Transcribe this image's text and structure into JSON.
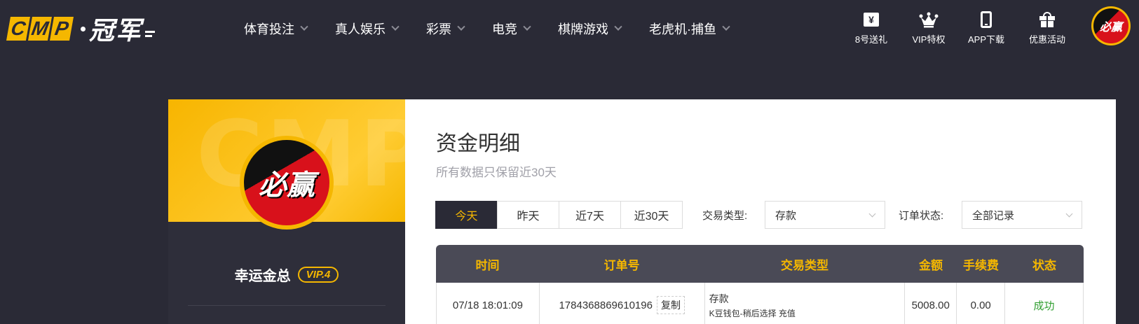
{
  "header": {
    "logo": {
      "letters": [
        "C",
        "M",
        "P"
      ],
      "text": "冠军"
    },
    "nav": [
      {
        "label": "体育投注"
      },
      {
        "label": "真人娱乐"
      },
      {
        "label": "彩票"
      },
      {
        "label": "电竞"
      },
      {
        "label": "棋牌游戏"
      },
      {
        "label": "老虎机·捕鱼"
      }
    ],
    "quick_links": [
      {
        "label": "8号送礼",
        "icon": "ticket-icon",
        "glyph": "¥"
      },
      {
        "label": "VIP特权",
        "icon": "crown-icon"
      },
      {
        "label": "APP下载",
        "icon": "phone-icon"
      },
      {
        "label": "优惠活动",
        "icon": "gift-icon"
      }
    ],
    "avatar_text": "必赢"
  },
  "sidebar": {
    "watermark": "CMP",
    "avatar_text": "必赢",
    "username": "幸运金总",
    "vip": "VIP.4"
  },
  "main": {
    "title": "资金明细",
    "subtitle": "所有数据只保留近30天",
    "tabs": [
      {
        "label": "今天",
        "active": true
      },
      {
        "label": "昨天",
        "active": false
      },
      {
        "label": "近7天",
        "active": false
      },
      {
        "label": "近30天",
        "active": false
      }
    ],
    "filters": {
      "type_label": "交易类型:",
      "type_value": "存款",
      "status_label": "订单状态:",
      "status_value": "全部记录"
    },
    "table": {
      "headers": [
        "时间",
        "订单号",
        "交易类型",
        "金额",
        "手续费",
        "状态"
      ],
      "rows": [
        {
          "time": "07/18 18:01:09",
          "order_no": "1784368869610196",
          "copy": "复制",
          "type_main": "存款",
          "type_detail": "K豆钱包-稍后选择 充值",
          "amount": "5008.00",
          "fee": "0.00",
          "status": "成功"
        }
      ]
    }
  },
  "colors": {
    "bg": "#2a2a36",
    "accent": "#f5b700",
    "table_header": "#4a4a56",
    "success": "#2f9e2f"
  }
}
